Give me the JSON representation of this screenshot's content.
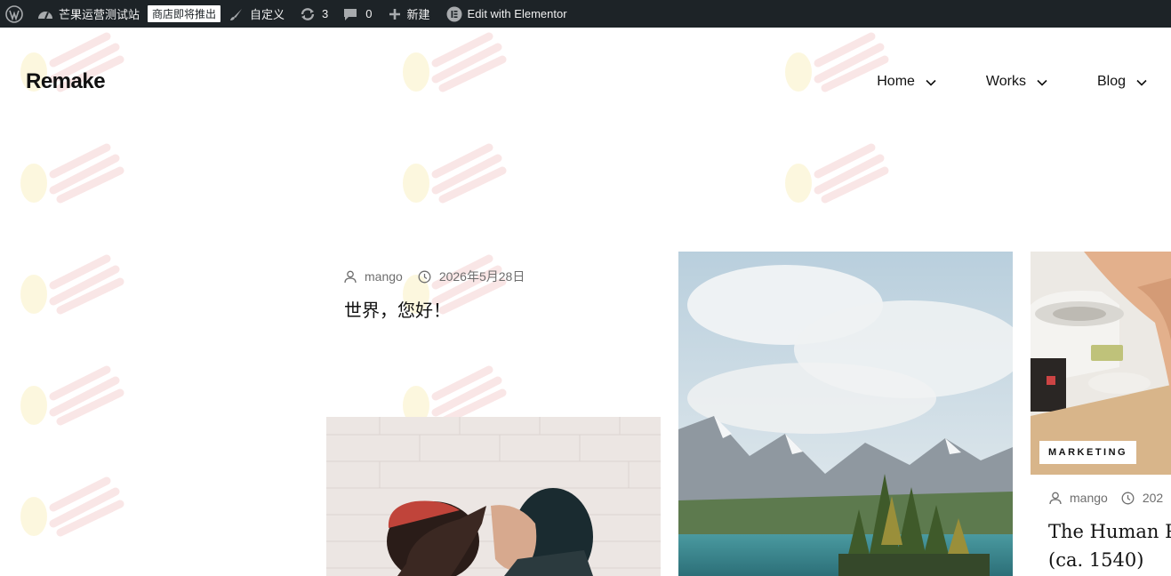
{
  "admin_bar": {
    "site_name": "芒果运营测试站",
    "store_badge": "商店即将推出",
    "customize": "自定义",
    "updates_count": "3",
    "comments_count": "0",
    "new_label": "新建",
    "elementor": "Edit with Elementor"
  },
  "header": {
    "brand": "Remake",
    "nav": [
      {
        "label": "Home"
      },
      {
        "label": "Works"
      },
      {
        "label": "Blog"
      }
    ]
  },
  "posts": [
    {
      "author": "mango",
      "date": "2026年5月28日",
      "title": "世界，您好！"
    },
    {
      "category": "MARKETING",
      "author": "mango",
      "date": "202",
      "title_line1": "The Human Pyra",
      "title_line2": "(ca. 1540)"
    }
  ],
  "icons": {
    "wp_logo": "wordpress-icon",
    "dashboard": "dashboard-icon",
    "brush": "brush-icon",
    "updates": "updates-icon",
    "comments": "comment-icon",
    "plus": "plus-icon",
    "elementor": "elementor-icon",
    "author": "user-icon",
    "date": "clock-icon"
  },
  "colors": {
    "admin_bar_bg": "#1d2327",
    "text": "#111111",
    "meta_text": "#6e6e6e"
  }
}
